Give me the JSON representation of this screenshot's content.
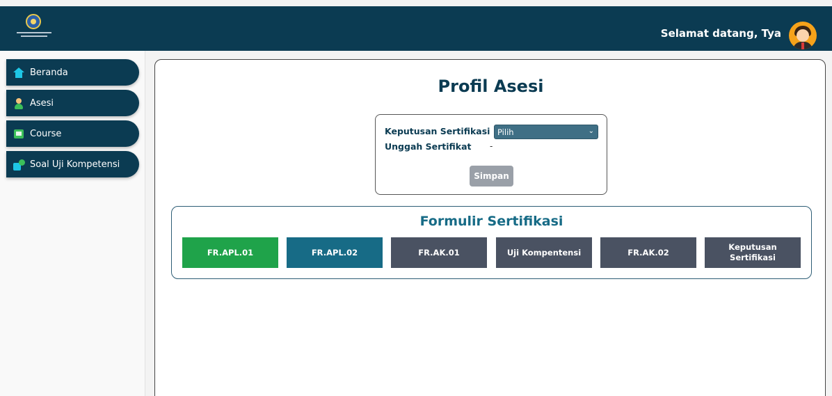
{
  "header": {
    "welcome_text": "Selamat datang, Tya",
    "brand_color": "#0b3b52"
  },
  "sidebar": {
    "items": [
      {
        "label": "Beranda",
        "icon": "home-icon"
      },
      {
        "label": "Asesi",
        "icon": "user-icon"
      },
      {
        "label": "Course",
        "icon": "course-icon"
      },
      {
        "label": "Soal Uji Kompetensi",
        "icon": "quiz-icon"
      }
    ]
  },
  "main": {
    "title": "Profil Asesi",
    "form": {
      "decision_label": "Keputusan Sertifikasi",
      "decision_value": "Pilih",
      "upload_label": "Unggah Sertifikat",
      "upload_value": "-",
      "save_label": "Simpan"
    },
    "forms_section": {
      "title": "Formulir Sertifikasi",
      "buttons": [
        {
          "label": "FR.APL.01",
          "color": "#1fa34a"
        },
        {
          "label": "FR.APL.02",
          "color": "#176b86"
        },
        {
          "label": "FR.AK.01",
          "color": "#4a5262"
        },
        {
          "label": "Uji Kompentensi",
          "color": "#4a5262"
        },
        {
          "label": "FR.AK.02",
          "color": "#4a5262"
        },
        {
          "label": "Keputusan Sertifikasi",
          "color": "#4a5262"
        }
      ]
    }
  }
}
